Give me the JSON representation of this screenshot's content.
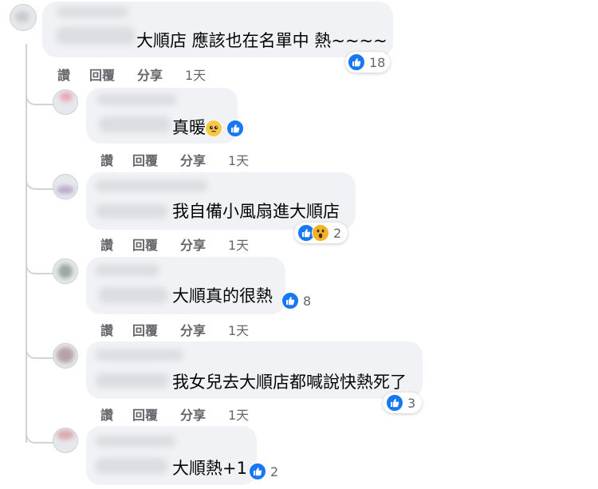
{
  "action_labels": {
    "like": "讚",
    "reply": "回覆",
    "share": "分享"
  },
  "comments": [
    {
      "text": "大順店 應該也在名單中 熱~~~~",
      "reactions": {
        "icons": [
          "like-icon"
        ],
        "count": "18"
      },
      "time": "1天"
    },
    {
      "text": "真暖",
      "reactions": {
        "icons": [
          "pleading-face-icon",
          "like-icon"
        ],
        "count": ""
      },
      "time": "1天"
    },
    {
      "text": "我自備小風扇進大順店",
      "reactions": {
        "icons": [
          "like-icon",
          "wow-icon"
        ],
        "count": "2"
      },
      "time": "1天"
    },
    {
      "text": "大順真的很熱",
      "reactions": {
        "icons": [
          "like-icon"
        ],
        "count": "8"
      },
      "time": "1天"
    },
    {
      "text": "我女兒去大順店都喊說快熱死了",
      "reactions": {
        "icons": [
          "like-icon"
        ],
        "count": "3"
      },
      "time": "1天"
    },
    {
      "text": "大順熱+1",
      "reactions": {
        "icons": [
          "like-icon"
        ],
        "count": "2"
      }
    }
  ],
  "colors": {
    "like_blue": "#1877f2",
    "bubble_bg": "#f0f2f5",
    "meta_gray": "#65676b"
  }
}
